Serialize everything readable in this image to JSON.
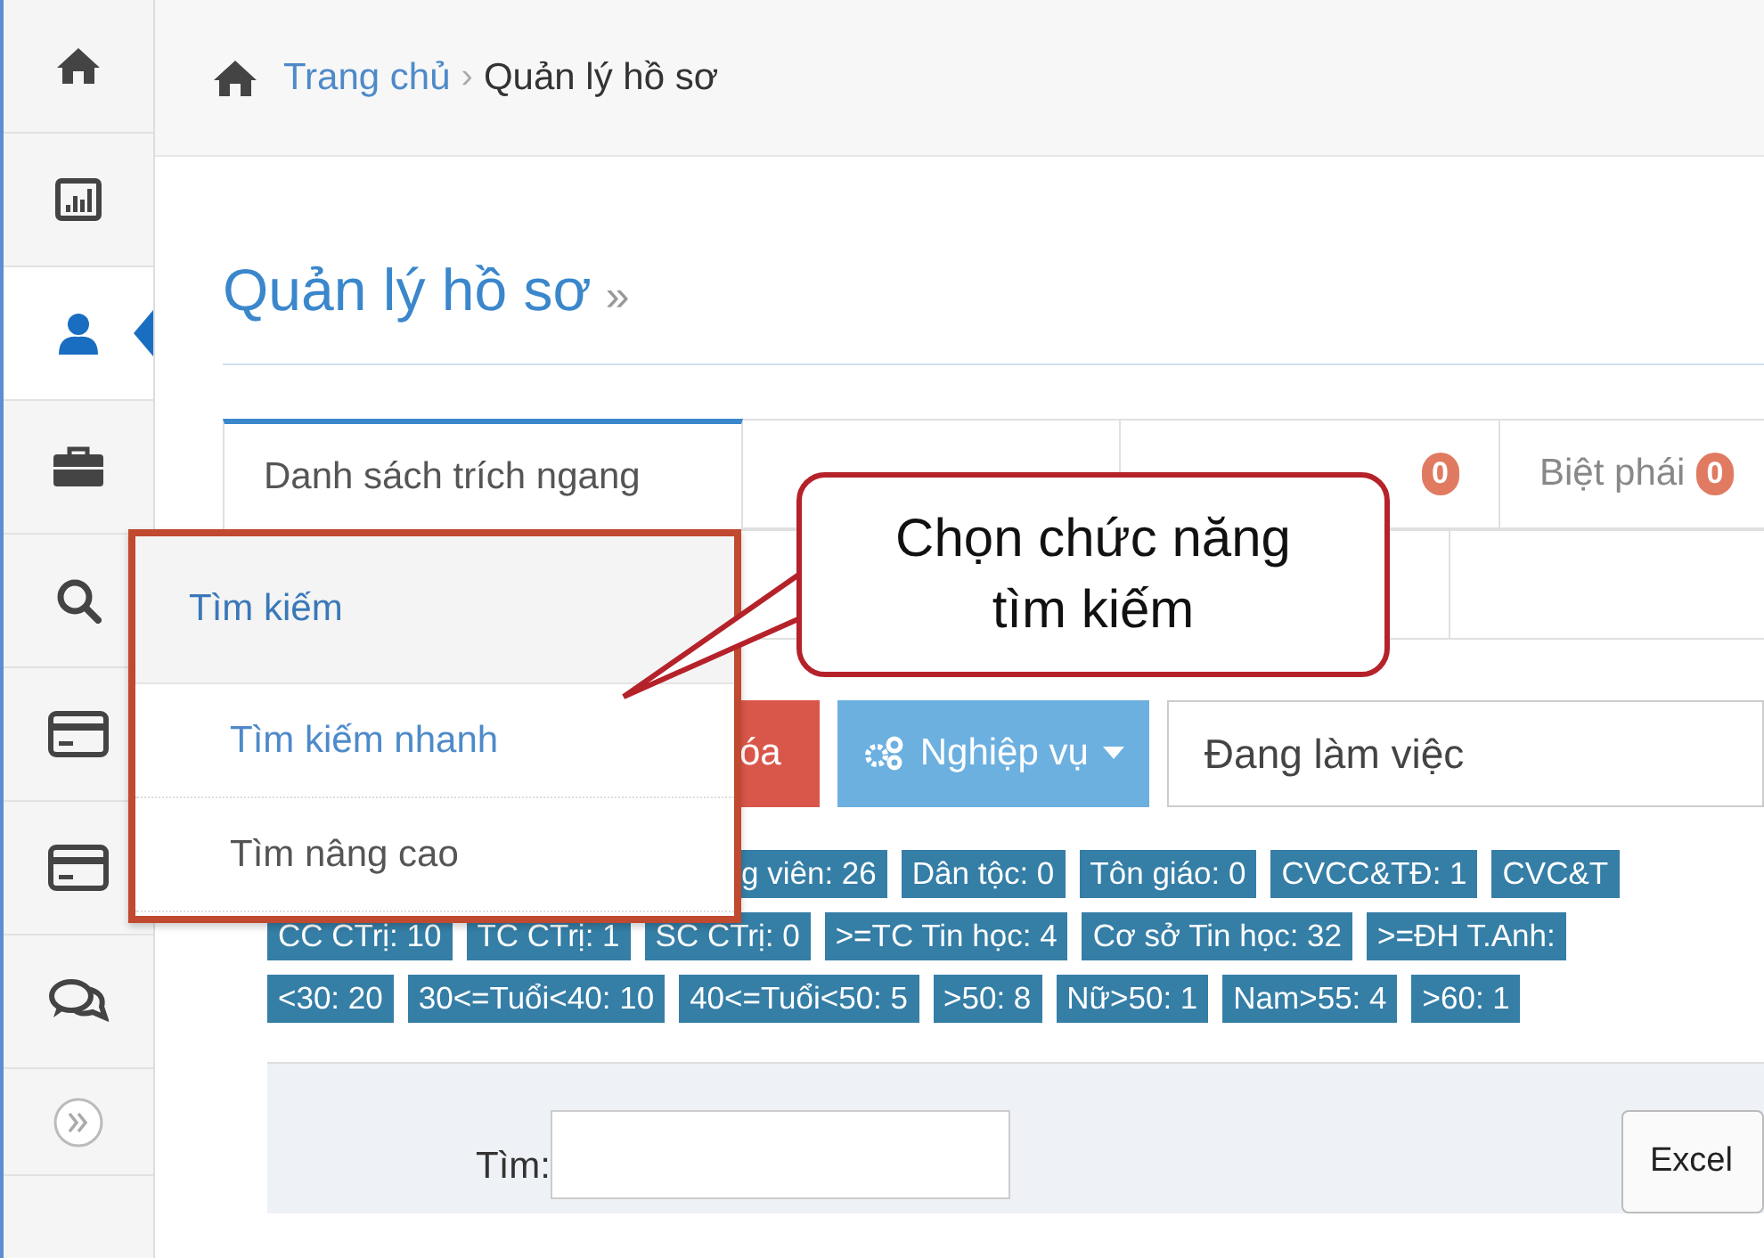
{
  "sidebar": {
    "items": [
      {
        "kind": "home",
        "selected": false
      },
      {
        "kind": "chart",
        "selected": false
      },
      {
        "kind": "user",
        "selected": true
      },
      {
        "kind": "briefcase",
        "selected": false
      },
      {
        "kind": "search",
        "selected": false
      },
      {
        "kind": "card",
        "selected": false
      },
      {
        "kind": "card",
        "selected": false
      },
      {
        "kind": "chat",
        "selected": false
      },
      {
        "kind": "expand",
        "selected": false
      }
    ]
  },
  "breadcrumb": {
    "items": [
      "Trang chủ",
      "Quản lý hồ sơ"
    ],
    "separator": "›"
  },
  "page_title": {
    "text": "Quản lý hồ sơ",
    "suffix": "»"
  },
  "tabs": [
    [
      {
        "label": "Danh sách trích ngang",
        "selected": true
      },
      {
        "selected": false
      },
      {
        "badge": "0",
        "selected": false
      },
      {
        "label": "Biệt phái",
        "badge": "0",
        "selected": false
      }
    ],
    [
      {
        "selected": false
      },
      {
        "selected": false
      }
    ]
  ],
  "toolbar": {
    "delete_button": "óa",
    "action_button": "Nghiệp vụ",
    "status_select": "Đang làm việc"
  },
  "tags": [
    [
      "g viên: 26",
      "Dân tộc: 0",
      "Tôn giáo: 0",
      "CVCC&TĐ: 1",
      "CVC&T"
    ],
    [
      "CC CTrị: 10",
      "TC CTrị: 1",
      "SC CTrị: 0",
      ">=TC Tin học: 4",
      "Cơ sở Tin học: 32",
      ">=ĐH T.Anh:"
    ],
    [
      "<30: 20",
      "30<=Tuổi<40: 10",
      "40<=Tuổi<50: 5",
      ">50: 8",
      "Nữ>50: 1",
      "Nam>55: 4",
      ">60: 1"
    ]
  ],
  "filter": {
    "label": "Tìm:",
    "button": "Excel"
  },
  "search_menu": {
    "title": "Tìm kiếm",
    "items": [
      {
        "label": "Tìm kiếm nhanh",
        "selected": true
      },
      {
        "label": "Tìm nâng cao",
        "selected": false
      }
    ]
  },
  "callout": {
    "text": "Chọn chức năng tìm kiếm"
  }
}
